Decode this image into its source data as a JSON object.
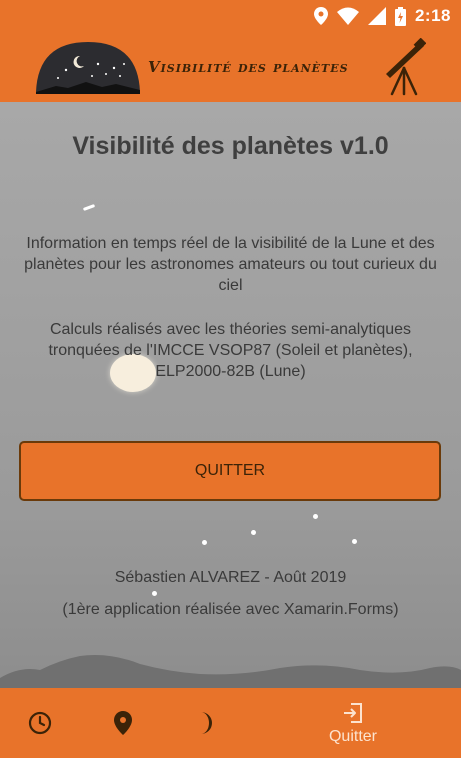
{
  "statusbar": {
    "time": "2:18"
  },
  "appbar": {
    "title": "Visibilité des planètes"
  },
  "main": {
    "title": "Visibilité des planètes v1.0",
    "paragraph1": "Information en temps réel de la visibilité de la Lune et des planètes pour les astronomes amateurs ou tout curieux du ciel",
    "paragraph2": "Calculs réalisés avec les théories semi-analytiques tronquées de l'IMCCE VSOP87 (Soleil et planètes), ELP2000-82B (Lune)",
    "quit_button": "QUITTER",
    "credit_author": "Sébastien ALVAREZ - Août 2019",
    "credit_note": "(1ère application réalisée avec Xamarin.Forms)"
  },
  "tabs": [
    {
      "icon": "clock-icon",
      "label": ""
    },
    {
      "icon": "location-pin-icon",
      "label": ""
    },
    {
      "icon": "moon-icon",
      "label": ""
    },
    {
      "icon": "exit-icon",
      "label": "Quitter"
    }
  ],
  "colors": {
    "accent": "#e8732a",
    "dark_brown": "#3b2308",
    "background": "#9c9c9c",
    "text": "#3a3a3a"
  }
}
